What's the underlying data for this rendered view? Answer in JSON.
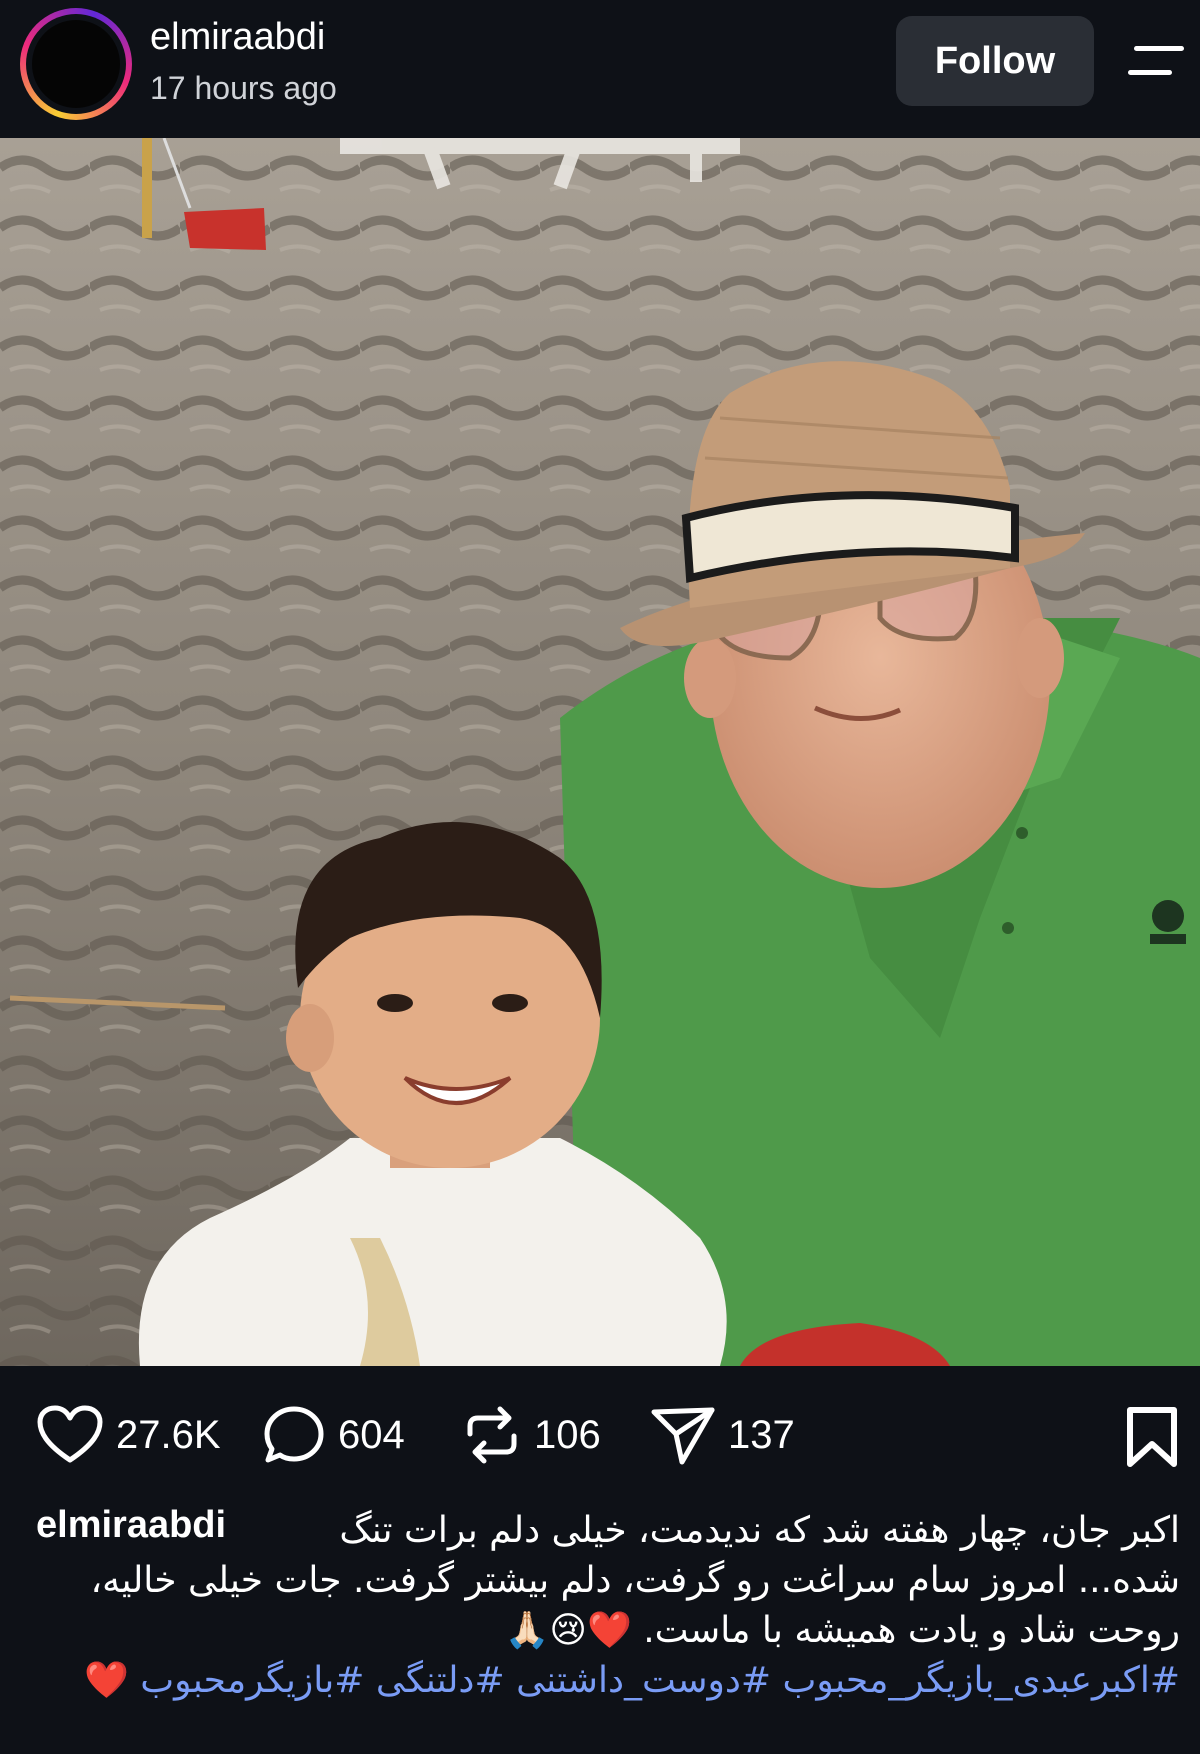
{
  "post": {
    "username": "elmiraabdi",
    "time_ago": "17 hours ago",
    "follow_label": "Follow"
  },
  "actions": {
    "likes": "27.6K",
    "comments": "604",
    "reposts": "106",
    "shares": "137"
  },
  "caption": {
    "username": "elmiraabdi",
    "line1": "اکبر جان، چهار هفته شد که ندیدمت، خیلی دلم برات تنگ",
    "line2": "شده... امروز سام سراغت رو گرفت، دلم بیشتر گرفت. جات خیلی خالیه،",
    "line3_text": "روحت شاد و یادت همیشه با ماست.",
    "line3_emojis": "❤️😢🙏🏻",
    "hashtags": "#اکبرعبدی_بازیگر_محبوب #دوست_داشتنی #دلتنگی #بازیگرمحبوب",
    "hashtags_emoji": "❤️"
  },
  "colors": {
    "background": "#0e1117",
    "follow_button": "#2a2e35",
    "hashtag": "#7a9cf5",
    "shirt_green": "#4f9a4a"
  },
  "icons": [
    "heart-icon",
    "comment-icon",
    "repost-icon",
    "share-icon",
    "bookmark-icon",
    "menu-icon"
  ]
}
